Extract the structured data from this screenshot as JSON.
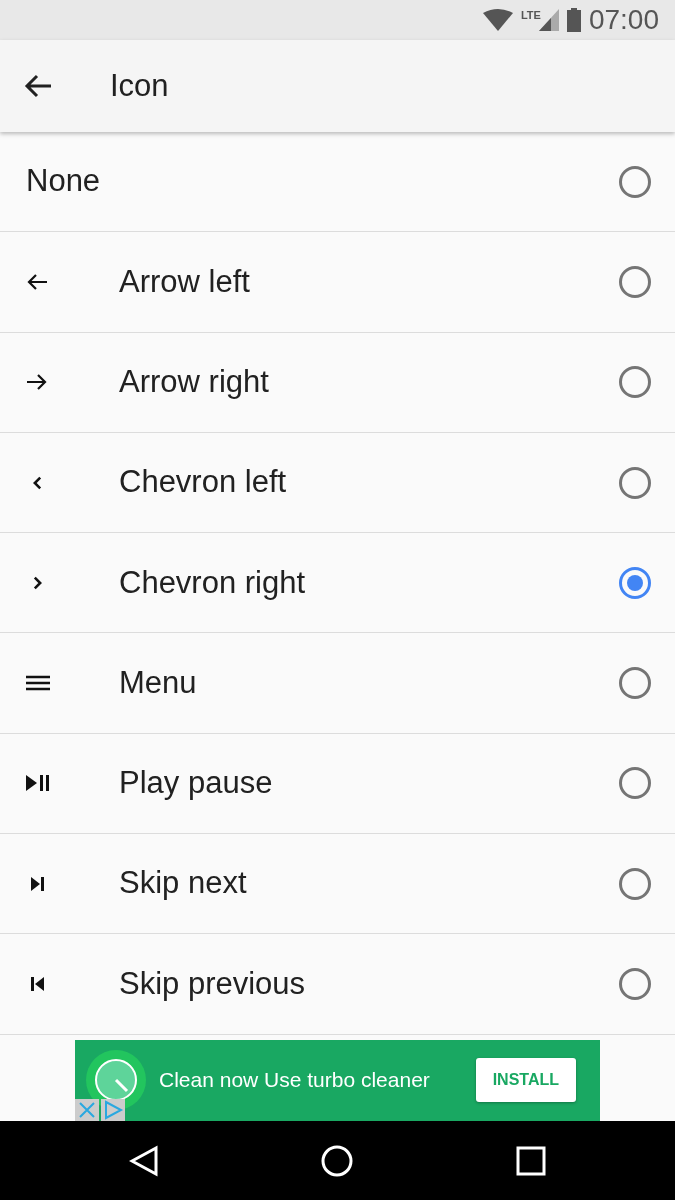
{
  "status_bar": {
    "network": "LTE",
    "time": "07:00"
  },
  "app_bar": {
    "title": "Icon"
  },
  "options": [
    {
      "label": "None",
      "kind": "plain",
      "selected": false
    },
    {
      "label": "Arrow left",
      "kind": "icon",
      "selected": false
    },
    {
      "label": "Arrow right",
      "kind": "icon",
      "selected": false
    },
    {
      "label": "Chevron left",
      "kind": "icon",
      "selected": false
    },
    {
      "label": "Chevron right",
      "kind": "icon",
      "selected": true
    },
    {
      "label": "Menu",
      "kind": "icon",
      "selected": false
    },
    {
      "label": "Play pause",
      "kind": "icon",
      "selected": false
    },
    {
      "label": "Skip next",
      "kind": "icon",
      "selected": false
    },
    {
      "label": "Skip previous",
      "kind": "icon",
      "selected": false
    }
  ],
  "ad": {
    "text": "Clean now Use turbo cleaner",
    "button": "INSTALL"
  }
}
